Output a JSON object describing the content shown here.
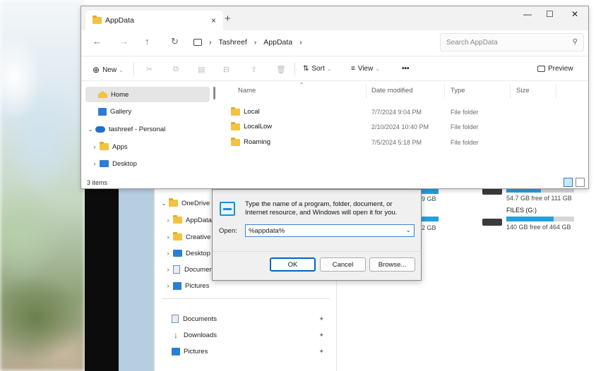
{
  "explorer": {
    "tab_title": "AppData",
    "tab_close": "×",
    "new_tab": "+",
    "window_controls": {
      "minimize": "—",
      "maximize": "☐",
      "close": "✕"
    },
    "nav": {
      "back": "←",
      "forward": "→",
      "up": "↑",
      "refresh": "↻"
    },
    "breadcrumb": [
      "Tashreef",
      "AppData"
    ],
    "breadcrumb_sep": "›",
    "search_placeholder": "Search AppData",
    "toolbar": {
      "new_label": "New",
      "sort_label": "Sort",
      "view_label": "View",
      "more_label": "•••",
      "preview_label": "Preview"
    },
    "sidebar": [
      {
        "label": "Home",
        "icon": "home-icon",
        "selected": true
      },
      {
        "label": "Gallery",
        "icon": "gallery-icon"
      },
      {
        "label": "tashreef - Personal",
        "icon": "cloud-icon",
        "expanded": true
      },
      {
        "label": "Apps",
        "icon": "folder-icon"
      },
      {
        "label": "Desktop",
        "icon": "desktop-icon"
      }
    ],
    "columns": {
      "name": "Name",
      "date": "Date modified",
      "type": "Type",
      "size": "Size"
    },
    "rows": [
      {
        "name": "Local",
        "date": "7/7/2024 9:04 PM",
        "type": "File folder"
      },
      {
        "name": "LocalLow",
        "date": "2/10/2024 10:40 PM",
        "type": "File folder"
      },
      {
        "name": "Roaming",
        "date": "7/5/2024 5:18 PM",
        "type": "File folder"
      }
    ],
    "status": "3 items"
  },
  "background_explorer": {
    "nav_items": [
      {
        "label": "OneDrive -",
        "icon": "cloud-icon"
      },
      {
        "label": "AppData",
        "icon": "folder-icon"
      },
      {
        "label": "Creative C",
        "icon": "folder-icon"
      },
      {
        "label": "Desktop",
        "icon": "desktop-icon"
      },
      {
        "label": "Documen",
        "icon": "document-icon"
      },
      {
        "label": "Pictures",
        "icon": "pictures-icon"
      }
    ],
    "quick_access": [
      {
        "label": "Documents",
        "icon": "document-icon"
      },
      {
        "label": "Downloads",
        "icon": "download-icon"
      },
      {
        "label": "Pictures",
        "icon": "pictures-icon"
      }
    ],
    "drives": {
      "left_partial_1": "9 GB",
      "left_partial_2": "2 GB",
      "drive_1_free": "54.7 GB free of 111 GB",
      "drive_1_fill": 0.51,
      "drive_2_name": "FILES (G:)",
      "drive_2_free": "140 GB free of 464 GB",
      "drive_2_fill": 0.7
    }
  },
  "run_dialog": {
    "message": "Type the name of a program, folder, document, or Internet resource, and Windows will open it for you.",
    "open_label": "Open:",
    "open_value": "%appdata%",
    "ok_label": "OK",
    "cancel_label": "Cancel",
    "browse_label": "Browse..."
  }
}
